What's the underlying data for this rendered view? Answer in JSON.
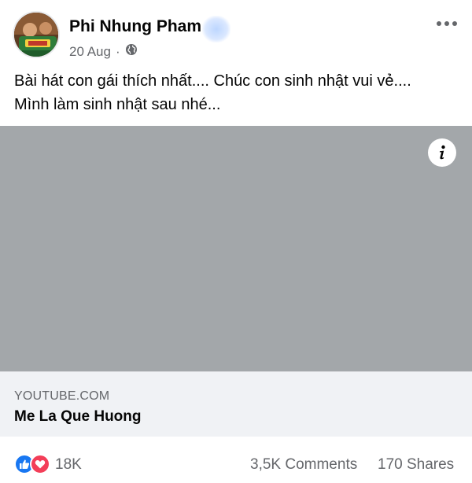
{
  "post": {
    "author_name": "Phi Nhung Pham",
    "date": "20 Aug",
    "separator": "·",
    "privacy_icon": "globe-icon",
    "text_line_1": "Bài hát con gái thích nhất.... Chúc con sinh nhật vui vẻ....",
    "text_line_2": "Mình làm sinh nhật sau nhé..."
  },
  "link_preview": {
    "domain": "YOUTUBE.COM",
    "title": "Me La Que Huong",
    "info_icon": "info-icon"
  },
  "engagement": {
    "reaction_icons": [
      "like-icon",
      "love-icon"
    ],
    "reaction_count": "18K",
    "comments": "3,5K Comments",
    "shares": "170 Shares"
  },
  "colors": {
    "like": "#1877f2",
    "love": "#f33e58",
    "media_placeholder": "#a3a7aa",
    "secondary_text": "#65676b"
  }
}
